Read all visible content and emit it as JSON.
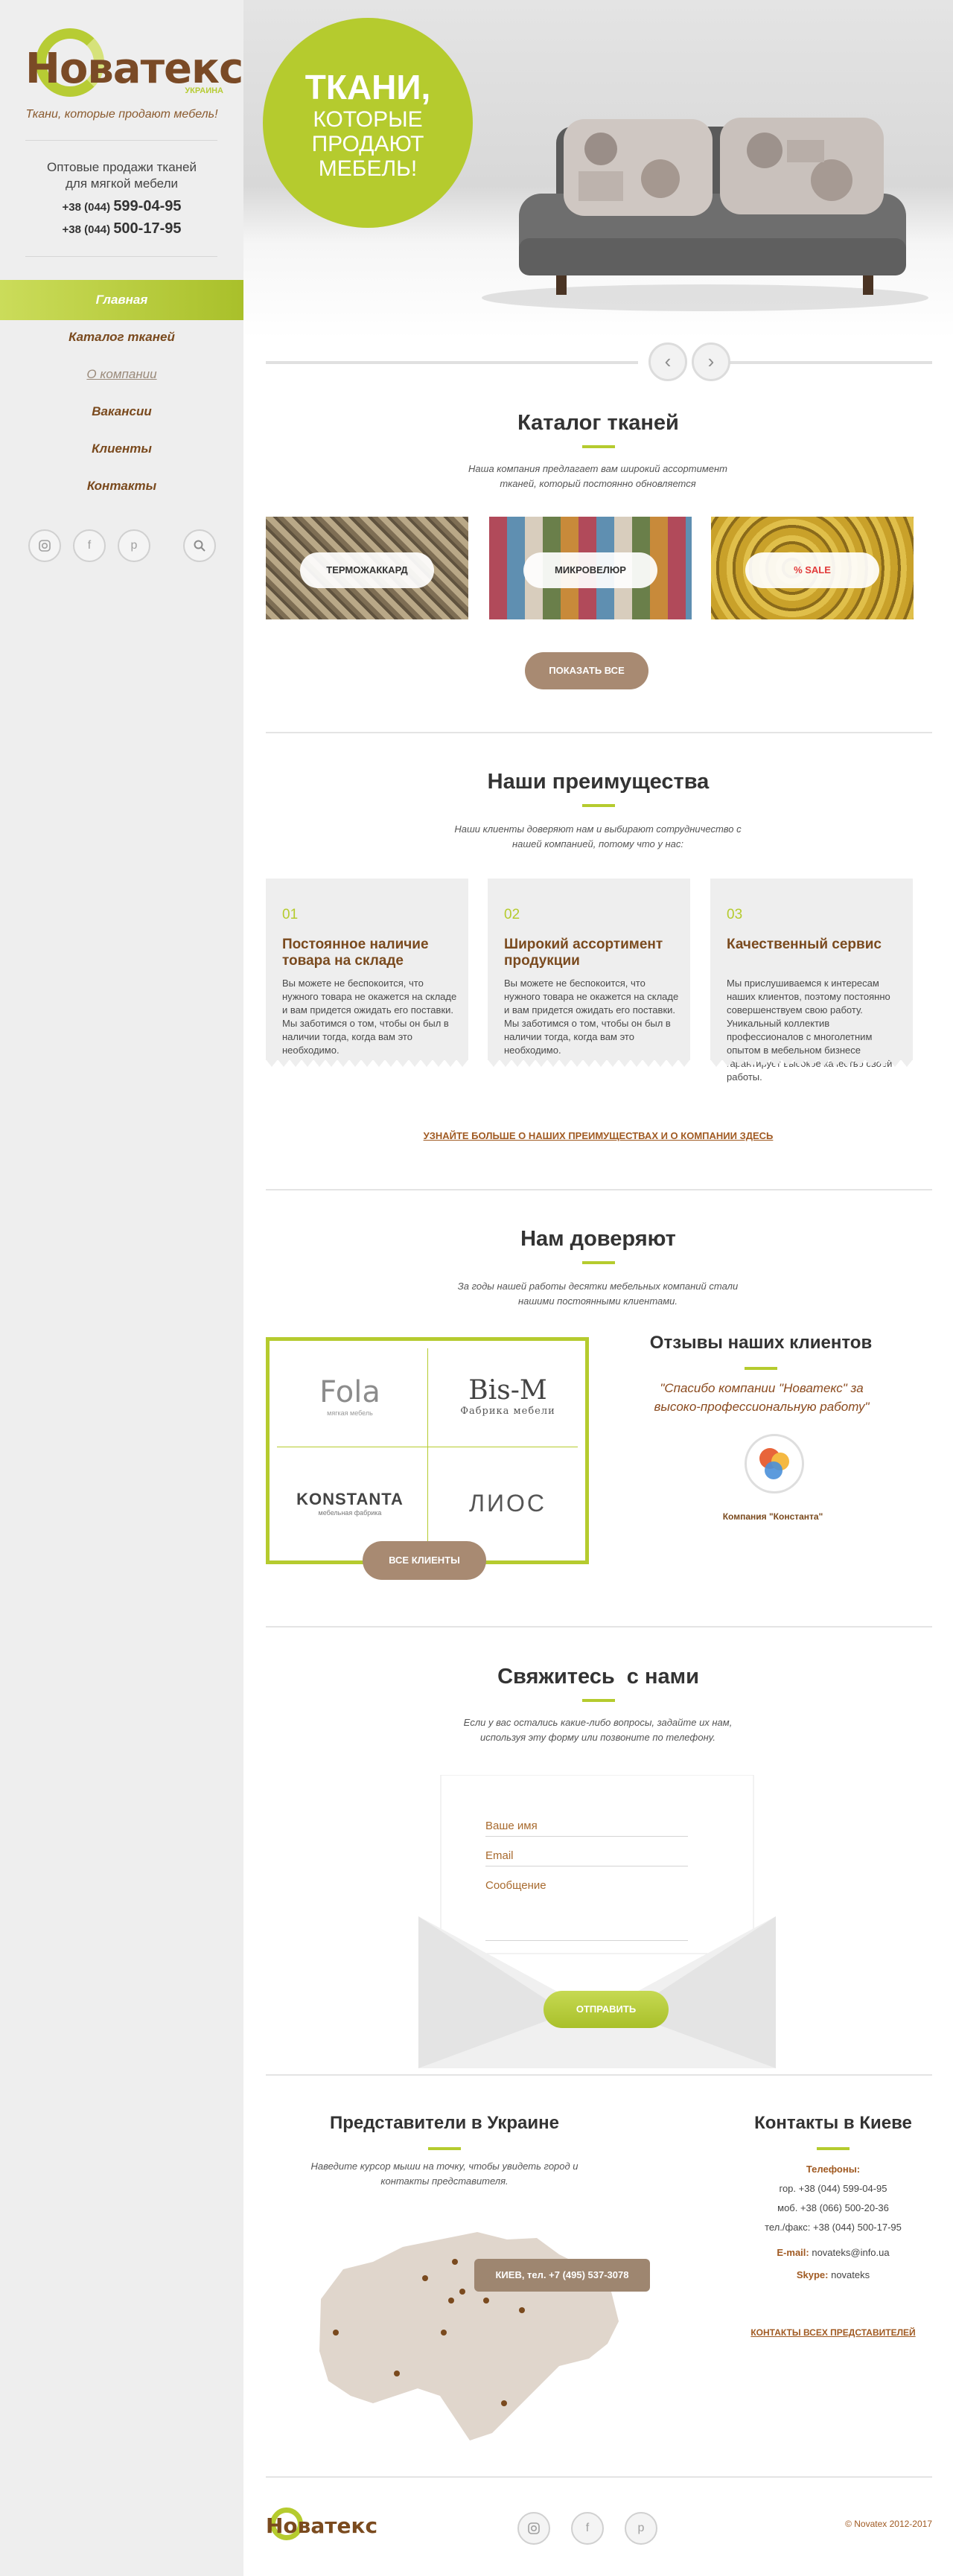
{
  "colors": {
    "accent_green": "#b5cb2e",
    "brand_brown": "#7a4a1e",
    "button_brown": "#a88a72",
    "sidebar_bg": "#eeeeee"
  },
  "sidebar": {
    "logo_text": "Новатекс",
    "logo_sub": "УКРАИНА",
    "tagline": "Ткани, которые продают мебель!",
    "wholesale": "Оптовые продажи тканей для мягкой мебели",
    "phones": [
      {
        "prefix": "+38 (044)",
        "number": "599-04-95"
      },
      {
        "prefix": "+38 (044)",
        "number": "500-17-95"
      }
    ],
    "menu": [
      {
        "label": "Главная",
        "state": "active"
      },
      {
        "label": "Каталог тканей",
        "state": "normal"
      },
      {
        "label": "О компании",
        "state": "muted"
      },
      {
        "label": "Вакансии",
        "state": "normal"
      },
      {
        "label": "Клиенты",
        "state": "normal"
      },
      {
        "label": "Контакты",
        "state": "normal"
      }
    ],
    "social_icons": [
      "instagram-icon",
      "facebook-icon",
      "pinterest-icon",
      "search-icon"
    ]
  },
  "hero": {
    "line1": "ТКАНИ,",
    "line2": "КОТОРЫЕ ПРОДАЮТ МЕБЕЛЬ!",
    "prev_icon": "arrow-left-icon",
    "next_icon": "arrow-right-icon"
  },
  "catalog": {
    "title_bold": "Каталог",
    "title_rest": " тканей",
    "desc": "Наша компания предлагает вам широкий ассортимент тканей, который постоянно обновляется",
    "items": [
      {
        "label": "ТЕРМОЖАККАРД"
      },
      {
        "label": "МИКРОВЕЛЮР"
      },
      {
        "label": "% SALE"
      }
    ],
    "show_all": "ПОКАЗАТЬ ВСЕ"
  },
  "advantages": {
    "title_bold": "Наши",
    "title_rest": " преимущества",
    "desc": "Наши клиенты доверяют нам и выбирают сотрудничество с нашей компанией, потому что у нас:",
    "items": [
      {
        "num": "01",
        "title": "Постоянное наличие товара на складе",
        "text": "Вы можете не беспокоится, что нужного товара не окажется на складе и вам придется ожидать его поставки. Мы заботимся о том, чтобы он был в наличии тогда, когда вам это необходимо."
      },
      {
        "num": "02",
        "title": "Широкий ассортимент продукции",
        "text": "Вы можете не беспокоится, что нужного товара не окажется на складе и вам придется ожидать его поставки. Мы заботимся о том, чтобы он был в наличии тогда, когда вам это необходимо."
      },
      {
        "num": "03",
        "title": "Качественный сервис",
        "text": "Мы прислушиваемся к интересам наших клиентов, поэтому постоянно совершенствуем свою работу. Уникальный коллектив профессионалов с многолетним опытом в мебельном бизнесе гарантирует высокое качество своей работы."
      }
    ],
    "more_link": "УЗНАЙТЕ БОЛЬШЕ О НАШИХ ПРЕИМУЩЕСТВАХ И О КОМПАНИИ ЗДЕСЬ"
  },
  "trust": {
    "title_bold": "Нам",
    "title_rest": " доверяют",
    "desc": "За годы нашей работы десятки мебельных компаний стали нашими постоянными клиентами.",
    "logos": [
      {
        "name": "Fola",
        "sub": "мягкая мебель"
      },
      {
        "name": "Bis-M",
        "sub": "Фабрика мебели"
      },
      {
        "name": "KONSTANTA",
        "sub": "мебельная фабрика"
      },
      {
        "name": "ЛИОС",
        "sub": ""
      }
    ],
    "all_clients": "ВСЕ КЛИЕНТЫ",
    "reviews_bold": "Отзывы",
    "reviews_rest": " наших клиентов",
    "review_text": "\"Спасибо компании \"Новатекс\" за высоко-профессиональную работу\"",
    "review_company": "Компания \"Константа\""
  },
  "contact_form": {
    "title_bold": "Свяжитесь",
    "title_rest": "  с нами",
    "desc": "Если у вас остались какие-либо вопросы, задайте их нам, используя эту форму или позвоните по телефону.",
    "name_placeholder": "Ваше имя",
    "email_placeholder": "Email",
    "message_placeholder": "Сообщение",
    "submit": "ОТПРАВИТЬ"
  },
  "representatives": {
    "title_bold": "Представители",
    "title_rest": " в Украине",
    "desc": "Наведите курсор мыши на точку, чтобы увидеть город и контакты представителя.",
    "tooltip": "КИЕВ, тел. +7 (495) 537-3078"
  },
  "contacts": {
    "title_bold": "Контакты",
    "title_rest": " в Киеве",
    "phones_label": "Телефоны:",
    "phone_city": "гор. +38 (044) 599-04-95",
    "phone_mobile": "моб. +38 (066) 500-20-36",
    "phone_fax": "тел./факс: +38 (044) 500-17-95",
    "email_label": "E-mail:",
    "email": " novateks@info.ua",
    "skype_label": "Skype:",
    "skype": " novateks",
    "all_reps_link": "КОНТАКТЫ ВСЕХ ПРЕДСТАВИТЕЛЕЙ"
  },
  "footer": {
    "logo_text": "Новатекс",
    "copyright": "© Novatex 2012-2017"
  }
}
